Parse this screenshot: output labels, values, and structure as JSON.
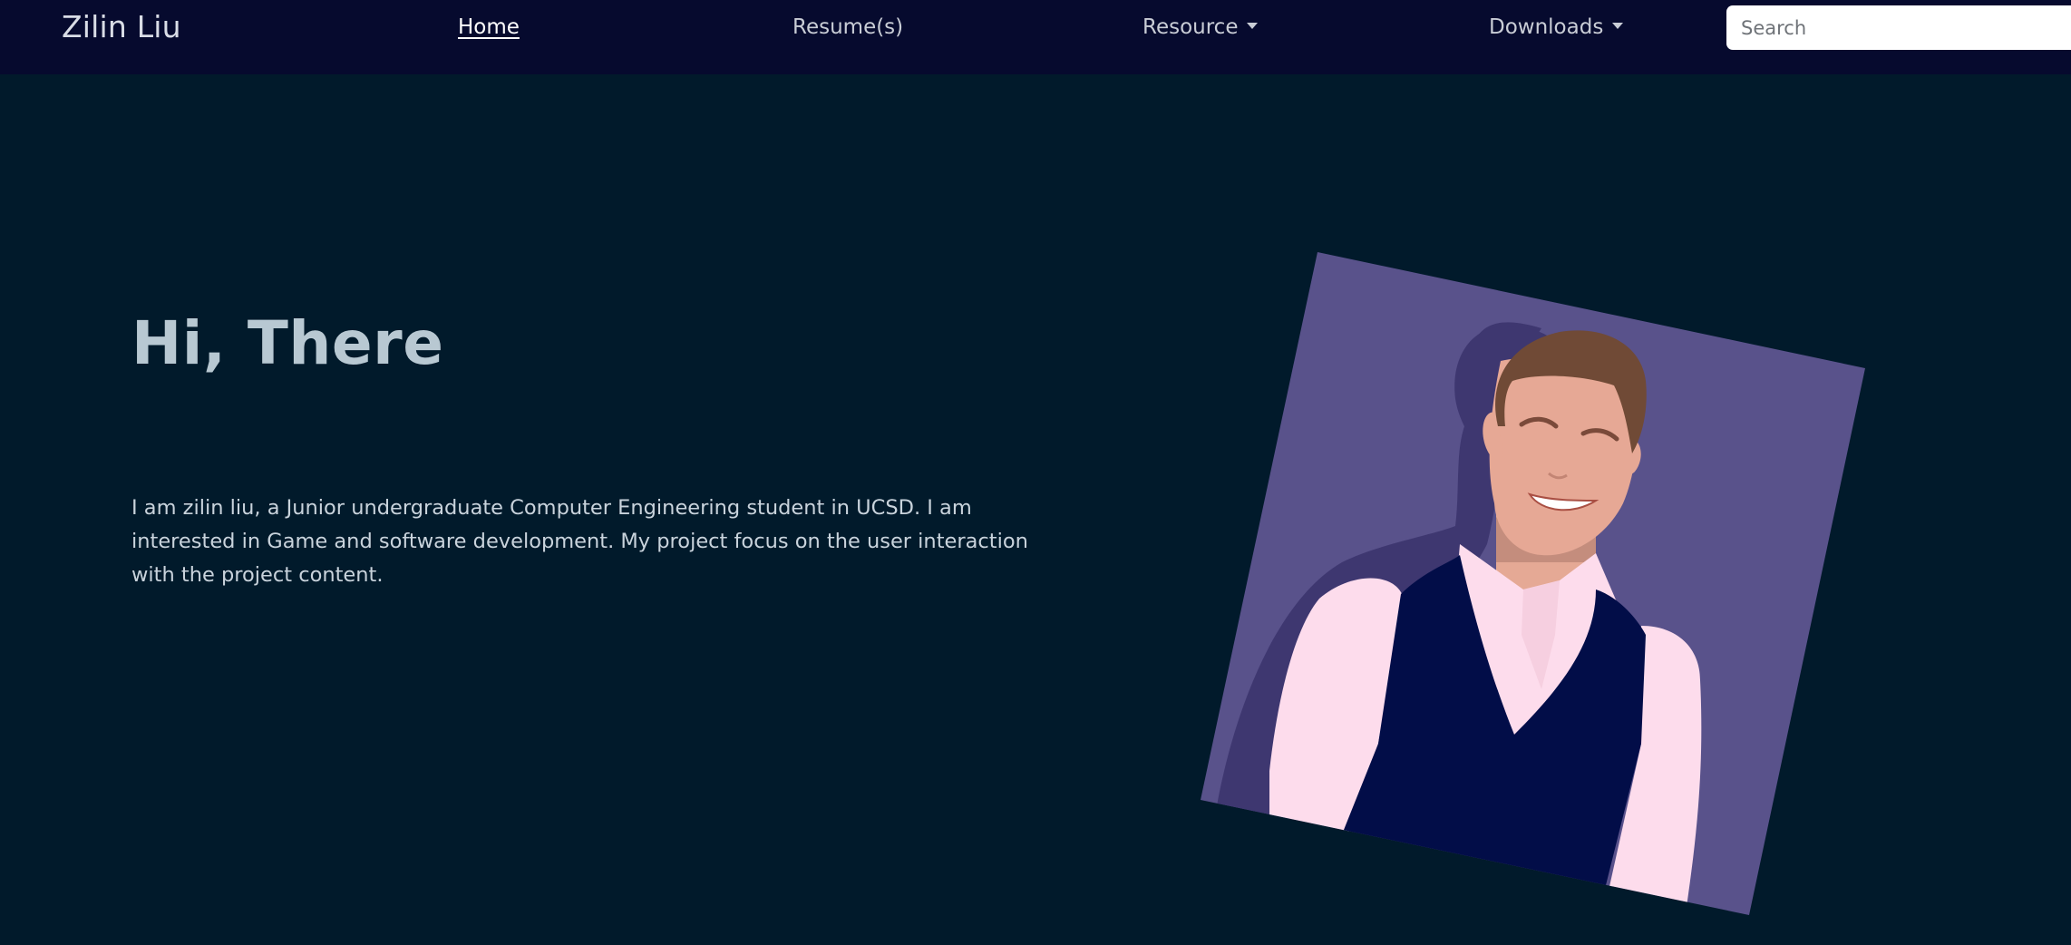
{
  "navbar": {
    "brand": "Zilin Liu",
    "links": [
      {
        "label": "Home",
        "active": true
      },
      {
        "label": "Resume(s)",
        "active": false
      },
      {
        "label": "Resource",
        "active": false,
        "dropdown": true
      },
      {
        "label": "Downloads",
        "active": false,
        "dropdown": true
      }
    ],
    "search_placeholder": "Search"
  },
  "hero": {
    "title": "Hi, There",
    "description": "I am zilin liu, a Junior undergraduate Computer Engineering student in UCSD. I am interested in Game and software development. My project focus on the user interaction with the project content."
  },
  "portrait": {
    "icon": "person-avatar-illustration",
    "background_color": "#59528b"
  },
  "colors": {
    "navbar_bg": "#060a2e",
    "page_bg": "#011a2b",
    "title": "#b8c8d2",
    "text": "#c9d3dc"
  }
}
